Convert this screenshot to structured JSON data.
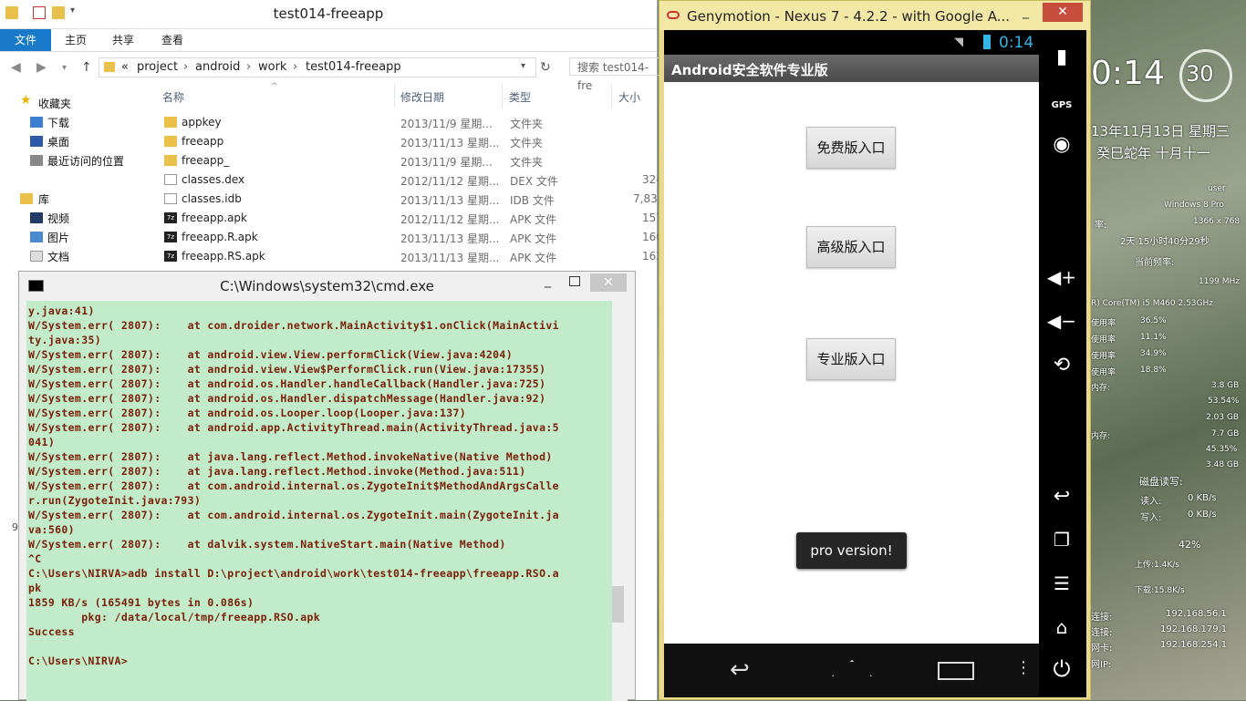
{
  "explorer": {
    "title": "test014-freeapp",
    "ribbon_tabs": [
      "文件",
      "主页",
      "共享",
      "查看"
    ],
    "breadcrumb": [
      "«",
      "project",
      "android",
      "work",
      "test014-freeapp"
    ],
    "search_placeholder": "搜索 test014-fre",
    "sidebar": {
      "favorites": "收藏夹",
      "items": [
        "下载",
        "桌面",
        "最近访问的位置"
      ],
      "library": "库",
      "lib_items": [
        "视频",
        "图片",
        "文档"
      ]
    },
    "columns": [
      "名称",
      "修改日期",
      "类型",
      "大小"
    ],
    "files": [
      {
        "name": "appkey",
        "date": "2013/11/9 星期...",
        "type": "文件夹",
        "size": ""
      },
      {
        "name": "freeapp",
        "date": "2013/11/13 星期...",
        "type": "文件夹",
        "size": ""
      },
      {
        "name": "freeapp_",
        "date": "2013/11/9 星期...",
        "type": "文件夹",
        "size": ""
      },
      {
        "name": "classes.dex",
        "date": "2012/11/12 星期...",
        "type": "DEX 文件",
        "size": "324"
      },
      {
        "name": "classes.idb",
        "date": "2013/11/13 星期...",
        "type": "IDB 文件",
        "size": "7,834"
      },
      {
        "name": "freeapp.apk",
        "date": "2012/11/12 星期...",
        "type": "APK 文件",
        "size": "157"
      },
      {
        "name": "freeapp.R.apk",
        "date": "2013/11/13 星期...",
        "type": "APK 文件",
        "size": "160"
      },
      {
        "name": "freeapp.RS.apk",
        "date": "2013/11/13 星期...",
        "type": "APK 文件",
        "size": "162"
      }
    ],
    "status_left": "9"
  },
  "cmd": {
    "title": "C:\\Windows\\system32\\cmd.exe",
    "lines": [
      "y.java:41)",
      "W/System.err( 2807):    at com.droider.network.MainActivity$1.onClick(MainActivi",
      "ty.java:35)",
      "W/System.err( 2807):    at android.view.View.performClick(View.java:4204)",
      "W/System.err( 2807):    at android.view.View$PerformClick.run(View.java:17355)",
      "W/System.err( 2807):    at android.os.Handler.handleCallback(Handler.java:725)",
      "W/System.err( 2807):    at android.os.Handler.dispatchMessage(Handler.java:92)",
      "W/System.err( 2807):    at android.os.Looper.loop(Looper.java:137)",
      "W/System.err( 2807):    at android.app.ActivityThread.main(ActivityThread.java:5",
      "041)",
      "W/System.err( 2807):    at java.lang.reflect.Method.invokeNative(Native Method)",
      "W/System.err( 2807):    at java.lang.reflect.Method.invoke(Method.java:511)",
      "W/System.err( 2807):    at com.android.internal.os.ZygoteInit$MethodAndArgsCalle",
      "r.run(ZygoteInit.java:793)",
      "W/System.err( 2807):    at com.android.internal.os.ZygoteInit.main(ZygoteInit.ja",
      "va:560)",
      "W/System.err( 2807):    at dalvik.system.NativeStart.main(Native Method)",
      "^C",
      "C:\\Users\\NIRVA>adb install D:\\project\\android\\work\\test014-freeapp\\freeapp.RSO.a",
      "pk",
      "1859 KB/s (165491 bytes in 0.086s)",
      "        pkg: /data/local/tmp/freeapp.RSO.apk",
      "Success",
      "",
      "C:\\Users\\NIRVA>"
    ]
  },
  "genymotion": {
    "title": "Genymotion - Nexus 7 - 4.2.2 - with Google A...",
    "clock": "0:14",
    "app_title": "Android安全软件专业版",
    "buttons": [
      "免费版入口",
      "高级版入口",
      "专业版入口"
    ],
    "toast": "pro version!",
    "side_gps": "GPS"
  },
  "gadget": {
    "time": "0:14",
    "seconds": "30",
    "date": "13年11月13日 星期三",
    "lunar": "癸巳蛇年 十月十一",
    "user": "user",
    "os": "Windows 8 Pro",
    "resolution": "1366 x 768",
    "resolution_label": "率:",
    "uptime": "2天 15小时40分29秒",
    "freq_label": "当前频率:",
    "freq": "1199 MHz",
    "cpu": "R) Core(TM) i5 M460 2.53GHz",
    "usage_label": "使用率",
    "usages": [
      "36.5%",
      "11.1%",
      "34.9%",
      "18.8%"
    ],
    "mem_label": "内存:",
    "mem_total": "3.8 GB",
    "mem_pct": "53.54%",
    "mem_used": "2.03 GB",
    "vmem_label": "内存:",
    "vmem_total": "7.7 GB",
    "vmem_pct": "45.35%",
    "vmem_used": "3.48 GB",
    "disk_label": "磁盘读写:",
    "read_label": "读入:",
    "read": "0 KB/s",
    "write_label": "写入:",
    "write": "0 KB/s",
    "pct42": "42%",
    "up": "上传:1.4K/s",
    "down": "下载:15.8K/s",
    "conn_label": "连接:",
    "ip1": "192.168.56.1",
    "ip2": "192.168.179.1",
    "nic_label": "网卡:",
    "ip3": "192.168.254.1",
    "ip_label": "网IP:"
  }
}
